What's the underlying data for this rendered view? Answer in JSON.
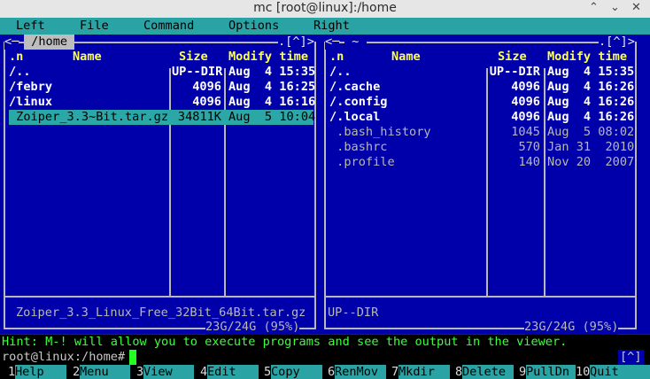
{
  "window": {
    "title": "mc [root@linux]:/home",
    "buttons": [
      "⌃",
      "⌄",
      "✕"
    ]
  },
  "menu": [
    "Left",
    "File",
    "Command",
    "Options",
    "Right"
  ],
  "left_panel": {
    "path": " /home ",
    "corner_left": "<─",
    "corner_right": ".[^]>",
    "headers": {
      "n": ".n",
      "name": "Name",
      "size": "Size",
      "modify": "Modify time"
    },
    "rows": [
      {
        "name": "/..",
        "size": "UP--DIR",
        "date": "Aug  4 15:35",
        "kind": "dir"
      },
      {
        "name": "/febry",
        "size": "4096",
        "date": "Aug  4 16:25",
        "kind": "dir"
      },
      {
        "name": "/linux",
        "size": "4096",
        "date": "Aug  4 16:16",
        "kind": "dir"
      },
      {
        "name": " Zoiper_3.3~Bit.tar.gz",
        "size": "34811K",
        "date": "Aug  5 10:04",
        "kind": "sel"
      }
    ],
    "status": "Zoiper_3.3_Linux_Free_32Bit_64Bit.tar.gz",
    "disk": "23G/24G (95%)"
  },
  "right_panel": {
    "path": " ~ ",
    "corner_left": "<─",
    "corner_right": ".[^]>",
    "headers": {
      "n": ".n",
      "name": "Name",
      "size": "Size",
      "modify": "Modify time"
    },
    "rows": [
      {
        "name": "/..",
        "size": "UP--DIR",
        "date": "Aug  4 15:35",
        "kind": "dir"
      },
      {
        "name": "/.cache",
        "size": "4096",
        "date": "Aug  4 16:26",
        "kind": "dir"
      },
      {
        "name": "/.config",
        "size": "4096",
        "date": "Aug  4 16:26",
        "kind": "dir"
      },
      {
        "name": "/.local",
        "size": "4096",
        "date": "Aug  4 16:26",
        "kind": "dir"
      },
      {
        "name": " .bash_history",
        "size": "1045",
        "date": "Aug  5 08:02",
        "kind": "file"
      },
      {
        "name": " .bashrc",
        "size": "570",
        "date": "Jan 31  2010",
        "kind": "file"
      },
      {
        "name": " .profile",
        "size": "140",
        "date": "Nov 20  2007",
        "kind": "file"
      }
    ],
    "status": "UP--DIR",
    "disk": "23G/24G (95%)"
  },
  "hint": "Hint: M-! will allow you to execute programs and see the output in the viewer.",
  "prompt": "root@linux:/home#",
  "prompt_corner": "[^]",
  "fkeys": [
    {
      "num": "1",
      "label": "Help"
    },
    {
      "num": "2",
      "label": "Menu"
    },
    {
      "num": "3",
      "label": "View"
    },
    {
      "num": "4",
      "label": "Edit"
    },
    {
      "num": "5",
      "label": "Copy"
    },
    {
      "num": "6",
      "label": "RenMov"
    },
    {
      "num": "7",
      "label": "Mkdir"
    },
    {
      "num": "8",
      "label": "Delete"
    },
    {
      "num": "9",
      "label": "PullDn"
    },
    {
      "num": "10",
      "label": "Quit"
    }
  ],
  "colors": {
    "panel_bg": "#0000aa",
    "menu_bg": "#29a3a3",
    "header_fg": "#ffff54",
    "hint_fg": "#3bff3b"
  }
}
